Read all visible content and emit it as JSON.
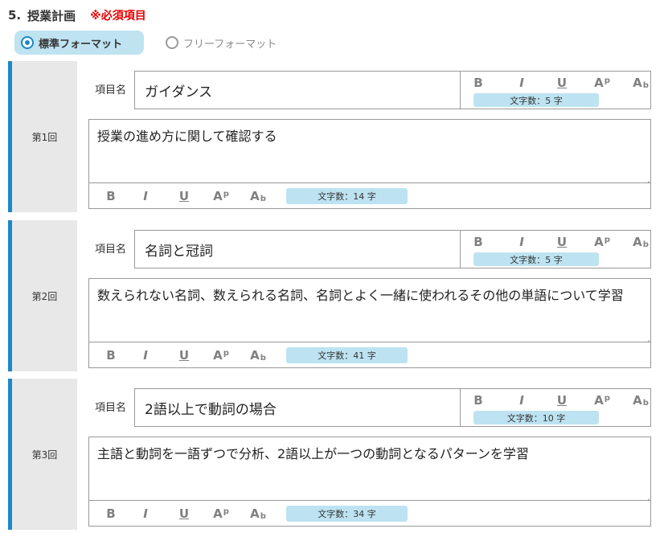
{
  "section": {
    "number": "5.",
    "title": "授業計画",
    "required": "※必須項目"
  },
  "format": {
    "standard": "標準フォーマット",
    "free": "フリーフォーマット",
    "selected": "standard"
  },
  "toolbar": {
    "bold": "B",
    "italic": "I",
    "underline": "U",
    "superscript_base": "A",
    "superscript_mark": "p",
    "subscript_base": "A",
    "subscript_mark": "b"
  },
  "item_label": "項目名",
  "char_count_prefix": "文字数：",
  "char_count_suffix": "字",
  "sessions": [
    {
      "label": "第1回",
      "title": "ガイダンス",
      "title_count": "5",
      "description": "授業の進め方に関して確認する",
      "description_count": "14"
    },
    {
      "label": "第2回",
      "title": "名詞と冠詞",
      "title_count": "5",
      "description": "数えられない名詞、数えられる名詞、名詞とよく一緒に使われるその他の単語について学習",
      "description_count": "41"
    },
    {
      "label": "第3回",
      "title": "2語以上で動詞の場合",
      "title_count": "10",
      "description": "主語と動詞を一語ずつで分析、2語以上が一つの動詞となるパターンを学習",
      "description_count": "34"
    }
  ]
}
